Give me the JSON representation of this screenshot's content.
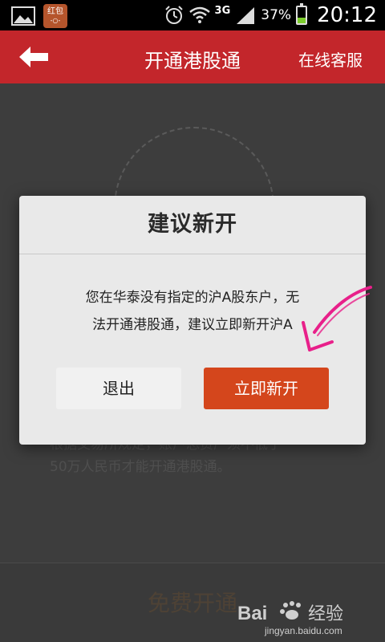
{
  "status_bar": {
    "hongbao_label": "红包",
    "network": "3G",
    "battery_percent": "37%",
    "battery_level": 0.37,
    "time": "20:12"
  },
  "header": {
    "title": "开通港股通",
    "service_label": "在线客服"
  },
  "background": {
    "notice_line1": "根据交易所规定，账户总资产须不低于",
    "notice_line2": "50万人民币才能开通港股通。",
    "free_open_label": "免费开通",
    "watermark_text": "经验",
    "watermark_url": "jingyan.baidu.com"
  },
  "dialog": {
    "title": "建议新开",
    "message_line1": "您在华泰没有指定的沪A股东户，无",
    "message_line2": "法开通港股通，建议立即新开沪A",
    "exit_label": "退出",
    "open_label": "立即新开"
  },
  "colors": {
    "header_red": "#c3262b",
    "primary_button": "#d4461c",
    "annotation_pink": "#e8208a"
  }
}
